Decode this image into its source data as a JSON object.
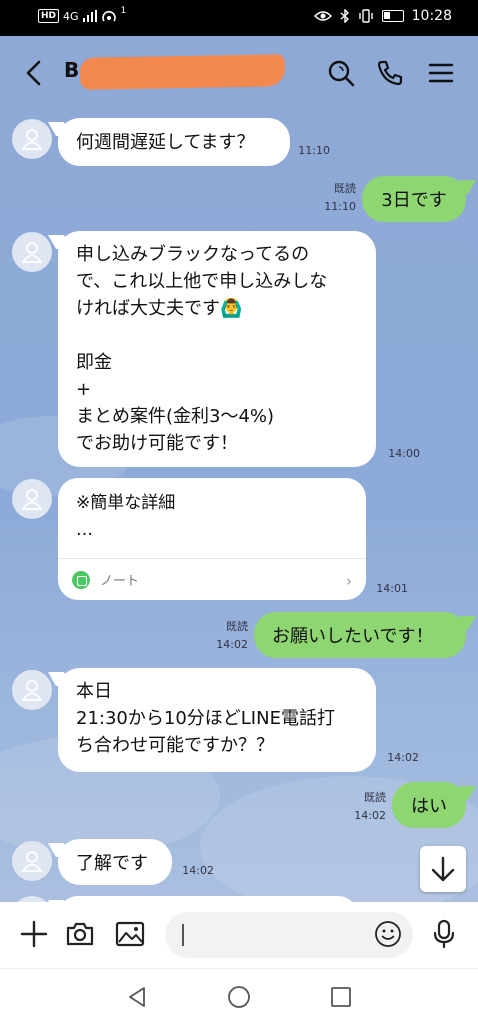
{
  "status_bar": {
    "network": "HD",
    "signal_text": "4G",
    "notification_count": "1",
    "time": "10:28"
  },
  "header": {
    "contact_name_partial": "B",
    "icons": [
      "back-icon",
      "search-icon",
      "phone-icon",
      "menu-icon"
    ]
  },
  "messages": [
    {
      "from": "them",
      "text": "何週間遅延してます？",
      "time": "11:10"
    },
    {
      "from": "me",
      "text": "3日です",
      "read": "既読",
      "time": "11:10"
    },
    {
      "from": "them",
      "text": "申し込みブラックなってるの\nで、これ以上他で申し込みしな\nければ大丈夫です🙆‍♂️\n\n即金\n+\nまとめ案件(金利3〜4%)\nでお助け可能です！",
      "time": "14:00"
    },
    {
      "from": "them",
      "type": "note",
      "text": "※簡単な詳細\n…",
      "note_label": "ノート",
      "time": "14:01"
    },
    {
      "from": "me",
      "text": "お願いしたいです！",
      "read": "既読",
      "time": "14:02"
    },
    {
      "from": "them",
      "text": "本日\n21:30から10分ほどLINE電話打\nち合わせ可能ですか？？",
      "time": "14:02"
    },
    {
      "from": "me",
      "text": "はい",
      "read": "既読",
      "time": "14:02"
    },
    {
      "from": "them",
      "text": "了解です",
      "time": "14:02"
    }
  ],
  "input": {
    "placeholder": "",
    "value": ""
  },
  "colors": {
    "chat_bg": "#8fa9d6",
    "outgoing_bubble": "#8ed671",
    "incoming_bubble": "#ffffff",
    "redaction": "#f3894e"
  }
}
